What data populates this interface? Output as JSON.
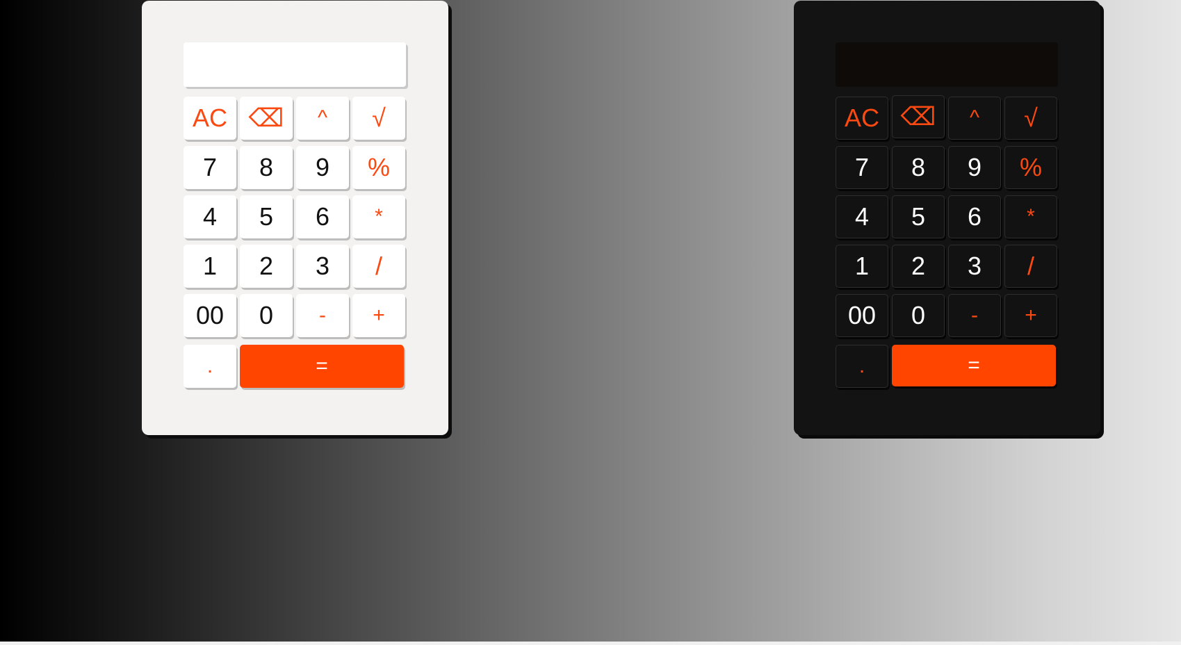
{
  "colors": {
    "accent": "#ff4500",
    "operator_text": "#fa4a12",
    "light_body": "#f3f2f1",
    "dark_body": "#131313"
  },
  "light_calculator": {
    "display_value": "",
    "keys": {
      "ac": "AC",
      "backspace": "⌫",
      "power": "^",
      "sqrt": "√",
      "seven": "7",
      "eight": "8",
      "nine": "9",
      "percent": "%",
      "four": "4",
      "five": "5",
      "six": "6",
      "multiply": "*",
      "one": "1",
      "two": "2",
      "three": "3",
      "divide": "/",
      "double_zero": "00",
      "zero": "0",
      "minus": "-",
      "plus": "+",
      "decimal": ".",
      "equals": "="
    }
  },
  "dark_calculator": {
    "display_value": "",
    "keys": {
      "ac": "AC",
      "backspace": "⌫",
      "power": "^",
      "sqrt": "√",
      "seven": "7",
      "eight": "8",
      "nine": "9",
      "percent": "%",
      "four": "4",
      "five": "5",
      "six": "6",
      "multiply": "*",
      "one": "1",
      "two": "2",
      "three": "3",
      "divide": "/",
      "double_zero": "00",
      "zero": "0",
      "minus": "-",
      "plus": "+",
      "decimal": ".",
      "equals": "="
    }
  }
}
